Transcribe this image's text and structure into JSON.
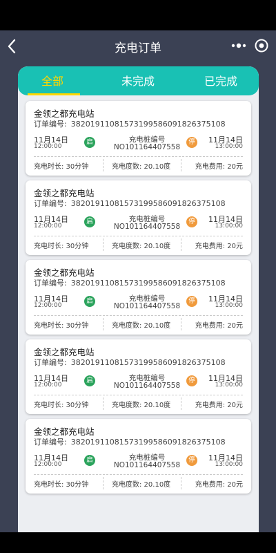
{
  "navbar": {
    "title": "充电订单",
    "back_icon": "chevron-left-icon",
    "more_icon": "more-dots-icon",
    "target_icon": "target-icon"
  },
  "tabs": [
    {
      "label": "全部",
      "active": true
    },
    {
      "label": "未完成",
      "active": false
    },
    {
      "label": "已完成",
      "active": false
    }
  ],
  "colors": {
    "background": "#3b4154",
    "tab_bar": "#19c1b4",
    "tab_active": "#ffd700",
    "start_badge": "#2ba35c",
    "stop_badge": "#f09a3c"
  },
  "orders": [
    {
      "station": "金领之都充电站",
      "order_label": "订单编号:",
      "order_no": "3820191108157319958609182637510​8",
      "start_date": "11月14日",
      "start_time": "12:00:00",
      "start_badge": "启",
      "pile_label": "充电桩编号",
      "pile_no": "NO101164407558",
      "stop_badge": "停",
      "end_date": "11月14日",
      "end_time": "13:00:00",
      "duration": "充电时长: 30分钟",
      "kwh": "充电度数: 20.10度",
      "fee": "充电费用: 20元"
    },
    {
      "station": "金领之都充电站",
      "order_label": "订单编号:",
      "order_no": "382019110815731995860918263751​08",
      "start_date": "11月14日",
      "start_time": "12:00:00",
      "start_badge": "启",
      "pile_label": "充电桩编号",
      "pile_no": "NO101164407558",
      "stop_badge": "停",
      "end_date": "11月14日",
      "end_time": "13:00:00",
      "duration": "充电时长: 30分钟",
      "kwh": "充电度数: 20.10度",
      "fee": "充电费用: 20元"
    },
    {
      "station": "金领之都充电站",
      "order_label": "订单编号:",
      "order_no": "38201911081573199586091826375108",
      "start_date": "11月14日",
      "start_time": "12:00:00",
      "start_badge": "启",
      "pile_label": "充电桩编号",
      "pile_no": "NO101164407558",
      "stop_badge": "停",
      "end_date": "11月14日",
      "end_time": "13:00:00",
      "duration": "充电时长: 30分钟",
      "kwh": "充电度数: 20.10度",
      "fee": "充电费用: 20元"
    },
    {
      "station": "金领之都充电站",
      "order_label": "订单编号:",
      "order_no": "38201911081573199586091826375108",
      "start_date": "11月14日",
      "start_time": "12:00:00",
      "start_badge": "启",
      "pile_label": "充电桩编号",
      "pile_no": "NO101164407558",
      "stop_badge": "停",
      "end_date": "11月14日",
      "end_time": "13:00:00",
      "duration": "充电时长: 30分钟",
      "kwh": "充电度数: 20.10度",
      "fee": "充电费用: 20元"
    },
    {
      "station": "金领之都充电站",
      "order_label": "订单编号:",
      "order_no": "38201911081573199586091826375108",
      "start_date": "11月14日",
      "start_time": "12:00:00",
      "start_badge": "启",
      "pile_label": "充电桩编号",
      "pile_no": "NO101164407558",
      "stop_badge": "停",
      "end_date": "11月14日",
      "end_time": "13:00:00",
      "duration": "充电时长: 30分钟",
      "kwh": "充电度数: 20.10度",
      "fee": "充电费用: 20元"
    }
  ]
}
